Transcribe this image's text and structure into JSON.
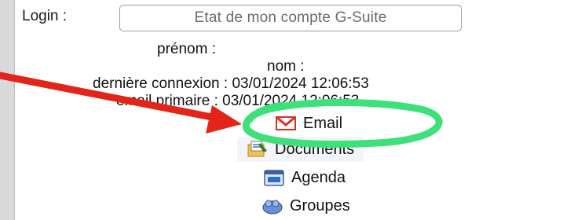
{
  "login": {
    "label": "Login :"
  },
  "account_button": {
    "label": "Etat de mon compte G-Suite"
  },
  "profile": {
    "prenom": "prénom :",
    "nom": "nom :",
    "derniere_connexion": "dernière connexion : 03/01/2024 12:06:53",
    "email_primaire": "email primaire : 03/01/2024 12:06:53"
  },
  "menu": [
    {
      "label": "Email",
      "icon": "gmail-icon"
    },
    {
      "label": "Documents",
      "icon": "documents-icon"
    },
    {
      "label": "Agenda",
      "icon": "calendar-icon"
    },
    {
      "label": "Groupes",
      "icon": "groups-icon"
    }
  ],
  "colors": {
    "annotation_arrow": "#e3241b",
    "annotation_circle": "#3ee07a",
    "gmail_red": "#d93025"
  }
}
